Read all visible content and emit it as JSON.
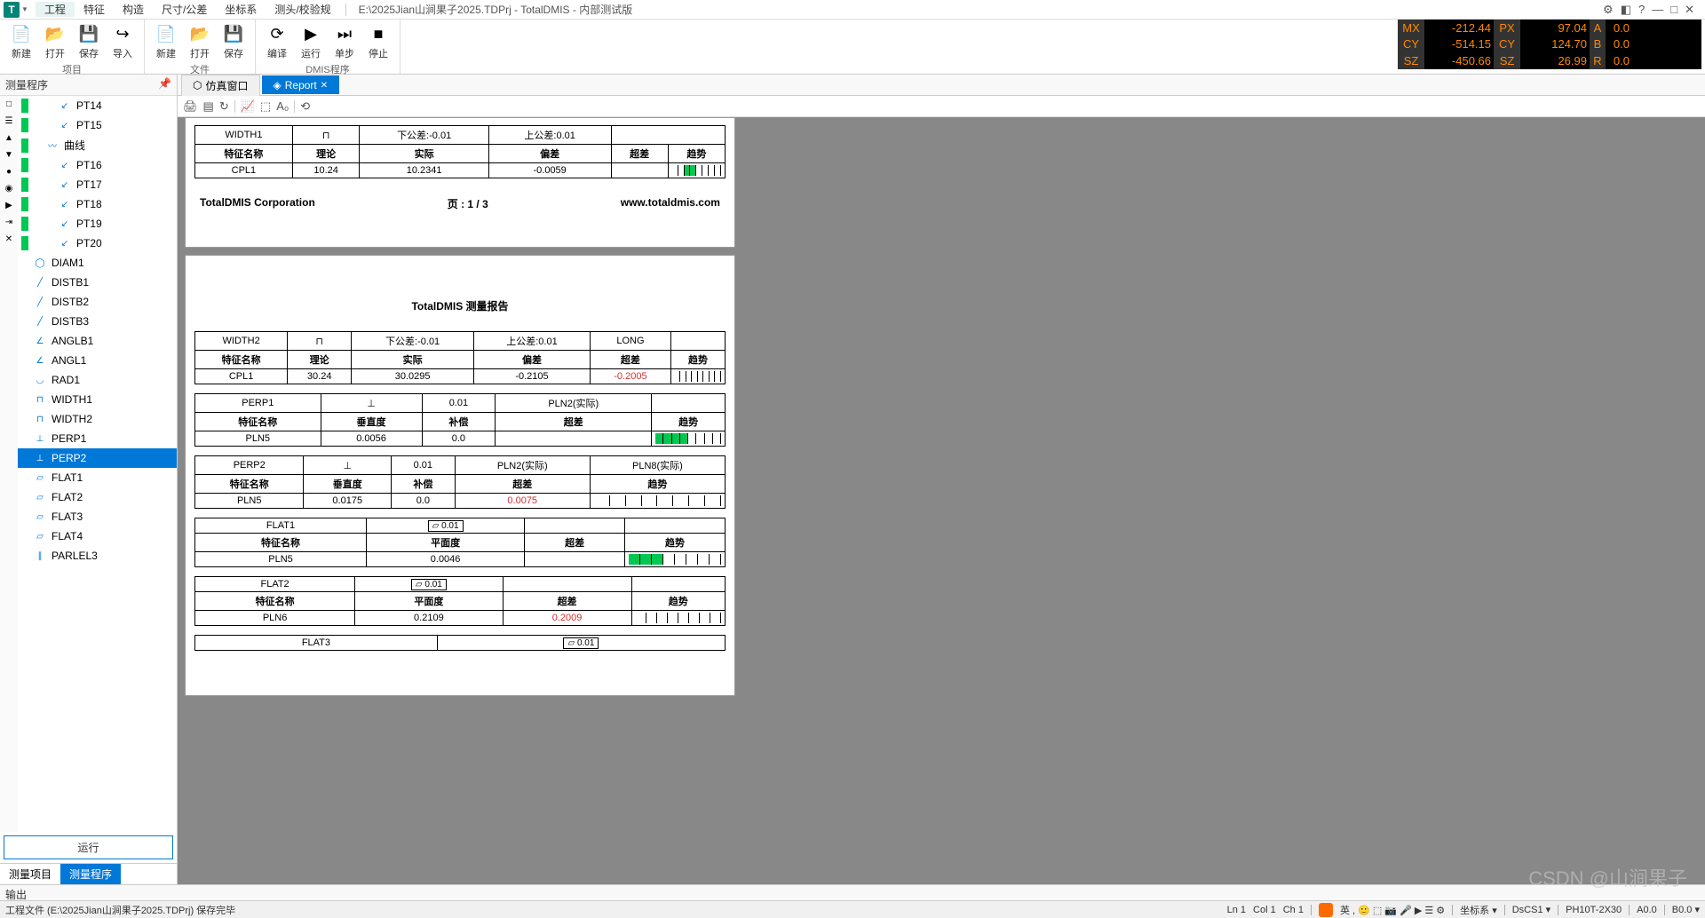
{
  "menu": {
    "items": [
      "工程",
      "特征",
      "构造",
      "尺寸/公差",
      "坐标系",
      "测头/校验规"
    ],
    "title": "E:\\2025Jian山涧果子2025.TDPrj - TotalDMIS - 内部测试版"
  },
  "winctl": {
    "gear": "⚙",
    "opt": "◧",
    "help": "?",
    "min": "—",
    "max": "□",
    "close": "✕"
  },
  "dro": {
    "r1": {
      "l1": "MX",
      "v1": "-212.44",
      "l2": "PX",
      "v2": "97.04",
      "l3": "A",
      "v3": "0.0"
    },
    "r2": {
      "l1": "CY",
      "v1": "-514.15",
      "l2": "CY",
      "v2": "124.70",
      "l3": "B",
      "v3": "0.0"
    },
    "r3": {
      "l1": "SZ",
      "v1": "-450.66",
      "l2": "SZ",
      "v2": "26.99",
      "l3": "R",
      "v3": "0.0"
    }
  },
  "ribbon": {
    "g1": {
      "label": "项目",
      "btns": [
        {
          "i": "📄",
          "t": "新建"
        },
        {
          "i": "📂",
          "t": "打开"
        },
        {
          "i": "💾",
          "t": "保存"
        },
        {
          "i": "↪",
          "t": "导入"
        }
      ]
    },
    "g2": {
      "label": "文件",
      "btns": [
        {
          "i": "📄",
          "t": "新建"
        },
        {
          "i": "📂",
          "t": "打开"
        },
        {
          "i": "💾",
          "t": "保存"
        }
      ]
    },
    "g3": {
      "label": "DMIS程序",
      "btns": [
        {
          "i": "⟳",
          "t": "编译"
        },
        {
          "i": "▶",
          "t": "运行"
        },
        {
          "i": "⏭",
          "t": "单步"
        },
        {
          "i": "■",
          "t": "停止"
        }
      ]
    }
  },
  "left": {
    "header": "测量程序",
    "tree": [
      {
        "ind": 2,
        "bar": true,
        "ico": "↙",
        "t": "PT14"
      },
      {
        "ind": 2,
        "bar": true,
        "ico": "↙",
        "t": "PT15"
      },
      {
        "ind": 1,
        "bar": true,
        "ico": "〰",
        "t": "曲线"
      },
      {
        "ind": 2,
        "bar": true,
        "ico": "↙",
        "t": "PT16"
      },
      {
        "ind": 2,
        "bar": true,
        "ico": "↙",
        "t": "PT17"
      },
      {
        "ind": 2,
        "bar": true,
        "ico": "↙",
        "t": "PT18"
      },
      {
        "ind": 2,
        "bar": true,
        "ico": "↙",
        "t": "PT19"
      },
      {
        "ind": 2,
        "bar": true,
        "ico": "↙",
        "t": "PT20"
      },
      {
        "ind": 0,
        "bar": false,
        "ico": "◯",
        "t": "DIAM1"
      },
      {
        "ind": 0,
        "bar": false,
        "ico": "╱",
        "t": "DISTB1"
      },
      {
        "ind": 0,
        "bar": false,
        "ico": "╱",
        "t": "DISTB2"
      },
      {
        "ind": 0,
        "bar": false,
        "ico": "╱",
        "t": "DISTB3"
      },
      {
        "ind": 0,
        "bar": false,
        "ico": "∠",
        "t": "ANGLB1"
      },
      {
        "ind": 0,
        "bar": false,
        "ico": "∠",
        "t": "ANGL1"
      },
      {
        "ind": 0,
        "bar": false,
        "ico": "◡",
        "t": "RAD1"
      },
      {
        "ind": 0,
        "bar": false,
        "ico": "⊓",
        "t": "WIDTH1"
      },
      {
        "ind": 0,
        "bar": false,
        "ico": "⊓",
        "t": "WIDTH2"
      },
      {
        "ind": 0,
        "bar": false,
        "ico": "⊥",
        "t": "PERP1"
      },
      {
        "ind": 0,
        "bar": false,
        "ico": "⊥",
        "t": "PERP2",
        "sel": true
      },
      {
        "ind": 0,
        "bar": false,
        "ico": "▱",
        "t": "FLAT1"
      },
      {
        "ind": 0,
        "bar": false,
        "ico": "▱",
        "t": "FLAT2"
      },
      {
        "ind": 0,
        "bar": false,
        "ico": "▱",
        "t": "FLAT3"
      },
      {
        "ind": 0,
        "bar": false,
        "ico": "▱",
        "t": "FLAT4"
      },
      {
        "ind": 0,
        "bar": false,
        "ico": "∥",
        "t": "PARLEL3"
      }
    ],
    "sideicons": [
      "□",
      "☰",
      "▲",
      "▼",
      "●",
      "◉",
      "▶",
      "⇥",
      "✕"
    ],
    "run": "运行",
    "tabs": {
      "t1": "测量项目",
      "t2": "测量程序"
    }
  },
  "tabs": {
    "t1": "仿真窗口",
    "t2": "Report"
  },
  "toolbar_icons": [
    "🖨",
    "▤",
    "↻",
    "│",
    "📈",
    "⬚",
    "A₀",
    "│",
    "⟲"
  ],
  "report": {
    "w1": {
      "name": "WIDTH1",
      "lower": "下公差:-0.01",
      "upper": "上公差:0.01",
      "hdr": [
        "特征名称",
        "理论",
        "实际",
        "偏差",
        "超差",
        "趋势"
      ],
      "row": [
        "CPL1",
        "10.24",
        "10.2341",
        "-0.0059",
        "",
        ""
      ]
    },
    "foot": {
      "corp": "TotalDMIS Corporation",
      "page": "页 : 1 / 3",
      "url": "www.totaldmis.com"
    },
    "title2": "TotalDMIS 测量报告",
    "w2": {
      "name": "WIDTH2",
      "lower": "下公差:-0.01",
      "upper": "上公差:0.01",
      "long": "LONG",
      "hdr": [
        "特征名称",
        "理论",
        "实际",
        "偏差",
        "超差",
        "趋势"
      ],
      "row": [
        "CPL1",
        "30.24",
        "30.0295",
        "-0.2105",
        "-0.2005",
        ""
      ]
    },
    "p1": {
      "name": "PERP1",
      "tol": "0.01",
      "ref": "PLN2(实际)",
      "hdr": [
        "特征名称",
        "垂直度",
        "补偿",
        "超差",
        "趋势"
      ],
      "row": [
        "PLN5",
        "0.0056",
        "0.0",
        "",
        ""
      ]
    },
    "p2": {
      "name": "PERP2",
      "tol": "0.01",
      "ref1": "PLN2(实际)",
      "ref2": "PLN8(实际)",
      "hdr": [
        "特征名称",
        "垂直度",
        "补偿",
        "超差",
        "趋势"
      ],
      "row": [
        "PLN5",
        "0.0175",
        "0.0",
        "0.0075",
        ""
      ]
    },
    "f1": {
      "name": "FLAT1",
      "tol": "0.01",
      "hdr": [
        "特征名称",
        "平面度",
        "超差",
        "趋势"
      ],
      "row": [
        "PLN5",
        "0.0046",
        "",
        ""
      ]
    },
    "f2": {
      "name": "FLAT2",
      "tol": "0.01",
      "hdr": [
        "特征名称",
        "平面度",
        "超差",
        "趋势"
      ],
      "row": [
        "PLN6",
        "0.2109",
        "0.2009",
        ""
      ]
    },
    "f3": {
      "name": "FLAT3",
      "tol": "0.01"
    }
  },
  "output": {
    "label": "输出"
  },
  "status": {
    "left": "工程文件 (E:\\2025Jian山涧果子2025.TDPrj) 保存完毕",
    "ln": "Ln 1",
    "col": "Col 1",
    "ch": "Ch 1",
    "ime": "英 , 🙂 ⬚ 📷 🎤 ▶ ☰ ⚙",
    "cs": "坐标系 ▾",
    "dscs": "DsCS1 ▾",
    "probe": "PH10T-2X30",
    "a": "A0.0",
    "b": "B0.0 ▾"
  },
  "watermark": "CSDN @山涧果子"
}
